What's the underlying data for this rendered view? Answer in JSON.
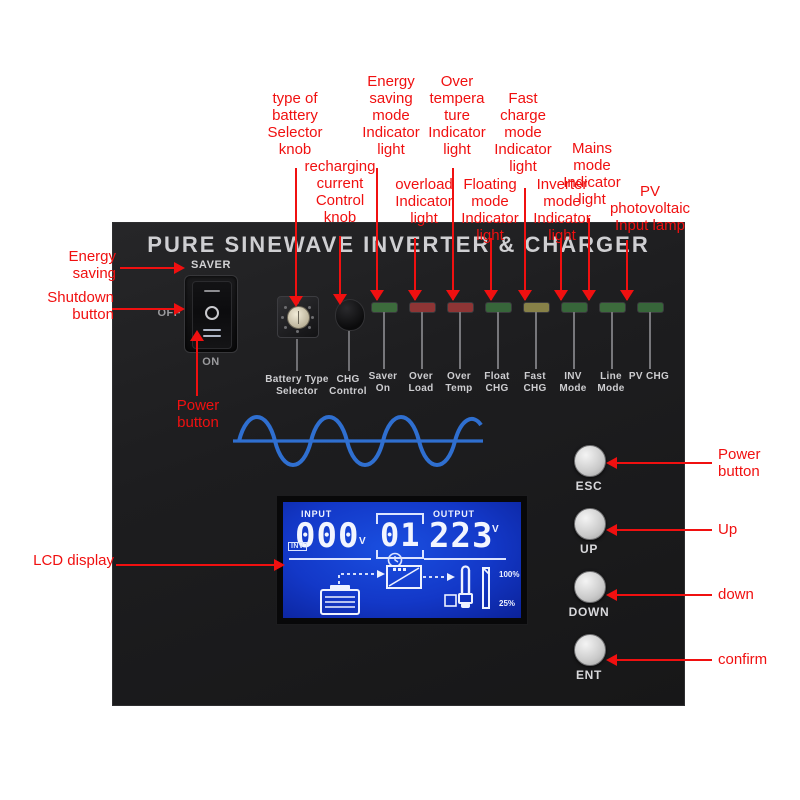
{
  "device": {
    "title": "PURE SINEWAVE INVERTER & CHARGER",
    "switch": {
      "saver_label": "SAVER",
      "off_label": "OFF",
      "on_label": "ON"
    },
    "controls": [
      {
        "name": "battery-type-selector",
        "label": "Battery Type\nSelector"
      },
      {
        "name": "chg-control",
        "label": "CHG\nControl"
      }
    ],
    "leds": [
      {
        "name": "saver-on",
        "label": "Saver\nOn",
        "color": "#3c6b3c"
      },
      {
        "name": "over-load",
        "label": "Over\nLoad",
        "color": "#8e3535"
      },
      {
        "name": "over-temp",
        "label": "Over\nTemp",
        "color": "#8e3535"
      },
      {
        "name": "float-chg",
        "label": "Float\nCHG",
        "color": "#37663a"
      },
      {
        "name": "fast-chg",
        "label": "Fast\nCHG",
        "color": "#878148"
      },
      {
        "name": "inv-mode",
        "label": "INV\nMode",
        "color": "#37663a"
      },
      {
        "name": "line-mode",
        "label": "Line\nMode",
        "color": "#3c6b3c"
      },
      {
        "name": "pv-chg",
        "label": "PV\nCHG",
        "color": "#37663a"
      }
    ],
    "buttons": [
      {
        "name": "esc",
        "label": "ESC"
      },
      {
        "name": "up",
        "label": "UP"
      },
      {
        "name": "down",
        "label": "DOWN"
      },
      {
        "name": "ent",
        "label": "ENT"
      }
    ],
    "lcd": {
      "input_header": "INPUT",
      "input_value": "000",
      "input_unit": "V",
      "inv_badge": "INV",
      "center_value": "01",
      "output_header": "OUTPUT",
      "output_value": "223",
      "output_unit": "V",
      "load_top": "100%",
      "load_bottom": "25%"
    }
  },
  "annotations": {
    "top": [
      {
        "name": "battery-type-knob",
        "text": "type of\nbattery\nSelector\nknob"
      },
      {
        "name": "recharging-current-knob",
        "text": "recharging\ncurrent\nControl\nknob"
      },
      {
        "name": "energy-saving-led",
        "text": "Energy\nsaving\nmode\nIndicator\nlight"
      },
      {
        "name": "overload-led",
        "text": "overload\nIndicator\nlight"
      },
      {
        "name": "over-temperature-led",
        "text": "Over\ntempera\nture\nIndicator\nlight"
      },
      {
        "name": "floating-mode-led",
        "text": "Floating\nmode\nIndicator\nlight"
      },
      {
        "name": "fast-charge-led",
        "text": "Fast\ncharge\nmode\nIndicator\nlight"
      },
      {
        "name": "inverter-mode-led",
        "text": "Inverter\nmode\nIndicator\nlight"
      },
      {
        "name": "mains-mode-led",
        "text": "Mains\nmode\nIndicator\nlight"
      },
      {
        "name": "pv-input-lamp",
        "text": "PV\nphotovoltaic\nInput lamp"
      }
    ],
    "left": [
      {
        "name": "energy-saving",
        "text": "Energy\nsaving"
      },
      {
        "name": "shutdown-button",
        "text": "Shutdown\nbutton"
      },
      {
        "name": "power-button",
        "text": "Power\nbutton"
      },
      {
        "name": "lcd-display",
        "text": "LCD display"
      }
    ],
    "right": [
      {
        "name": "power-button",
        "text": "Power\nbutton"
      },
      {
        "name": "up",
        "text": "Up"
      },
      {
        "name": "down",
        "text": "down"
      },
      {
        "name": "confirm",
        "text": "confirm"
      }
    ]
  }
}
